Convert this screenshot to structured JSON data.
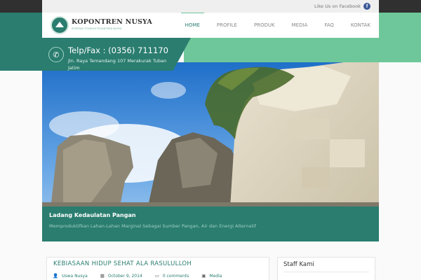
{
  "topbar": {
    "facebook_text": "Like Us on Facebook",
    "facebook_icon": "facebook-icon"
  },
  "header": {
    "logo_title": "KOPONTREN NUSYA",
    "logo_tagline": "KOPERASI PONDOK PESANTREN NUSYA",
    "nav": [
      "HOME",
      "PROFILE",
      "PRODUK",
      "MEDIA",
      "FAQ",
      "KONTAK"
    ],
    "active_nav": "HOME"
  },
  "contact": {
    "phone": "Telp/Fax : (0356) 711170",
    "address": "Jln. Raya Temandang 107 Merakurak Tuban Jatim"
  },
  "hero": {
    "title": "Ladang Kedaulatan Pangan",
    "subtitle": "Memproduktifkan Lahan-Lahan Marginal Sebagai Sumber Pangan, Air dan Energi Alternatif"
  },
  "post": {
    "title": "KEBIASAAN HIDUP SEHAT ALA RASULULLOH",
    "author": "Uswa Nusya",
    "date": "October 9, 2014",
    "comments": "0 comments",
    "category": "Media"
  },
  "sidebar": {
    "title": "Staff Kami"
  },
  "colors": {
    "primary": "#2a7d6f",
    "accent": "#6ec79a",
    "topbar": "#303030"
  }
}
